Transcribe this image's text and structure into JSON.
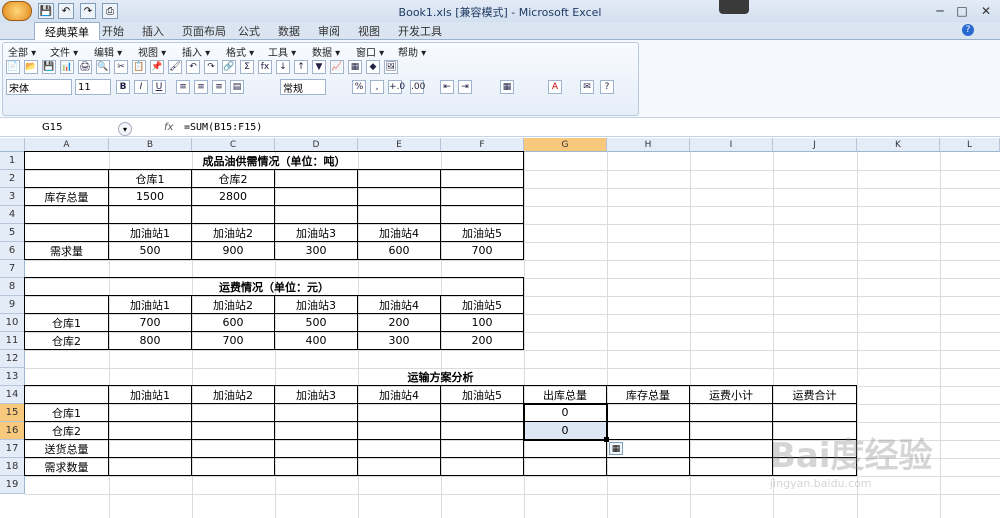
{
  "window": {
    "title": "Book1.xls  [兼容模式] - Microsoft Excel",
    "controls": {
      "minimize": "─",
      "restore": "□",
      "close": "✕"
    }
  },
  "quick_access": [
    "💾",
    "↶",
    "↷",
    "⎙"
  ],
  "ribbon_tabs": [
    "经典菜单",
    "开始",
    "插入",
    "页面布局",
    "公式",
    "数据",
    "审阅",
    "视图",
    "开发工具"
  ],
  "classic_menu": [
    "全部 ▾",
    "文件 ▾",
    "编辑 ▾",
    "视图 ▾",
    "插入 ▾",
    "格式 ▾",
    "工具 ▾",
    "数据 ▾",
    "窗口 ▾",
    "帮助 ▾"
  ],
  "toolbar": {
    "font_name": "宋体",
    "font_size": "11",
    "number_format": "常规",
    "row1_icons": [
      "📄",
      "📂",
      "💾",
      "📊",
      "🖨",
      "🔍",
      "✂",
      "📋",
      "📌",
      "🖌",
      "↶",
      "↷",
      "🔗",
      "Σ",
      "fx",
      "↓",
      "↑",
      "▼",
      "📈",
      "▦",
      "◆",
      "🖼"
    ],
    "row2_icons": [
      "B",
      "I",
      "U",
      "≡",
      "≡",
      "≡",
      "▤",
      "%",
      ",",
      "+.0",
      ".00",
      "⇤",
      "⇥",
      "▦",
      "A",
      "✉",
      "?"
    ]
  },
  "formula_bar": {
    "name_box": "G15",
    "fx": "fx",
    "formula": "=SUM(B15:F15)"
  },
  "sheet": {
    "columns": [
      "A",
      "B",
      "C",
      "D",
      "E",
      "F",
      "G",
      "H",
      "I",
      "J",
      "K",
      "L"
    ],
    "rows": [
      "1",
      "2",
      "3",
      "4",
      "5",
      "6",
      "7",
      "8",
      "9",
      "10",
      "11",
      "12",
      "13",
      "14",
      "15",
      "16",
      "17",
      "18",
      "19"
    ],
    "selected_column": "G",
    "titles": {
      "r1": "成品油供需情况（单位：吨）",
      "r8": "运费情况（单位：元）",
      "r13": "运输方案分析"
    },
    "r2": [
      "仓库1",
      "仓库2"
    ],
    "r3": {
      "label": "库存总量",
      "values": [
        "1500",
        "2800"
      ]
    },
    "r5": [
      "加油站1",
      "加油站2",
      "加油站3",
      "加油站4",
      "加油站5"
    ],
    "r6": {
      "label": "需求量",
      "values": [
        "500",
        "900",
        "300",
        "600",
        "700"
      ]
    },
    "r9": [
      "加油站1",
      "加油站2",
      "加油站3",
      "加油站4",
      "加油站5"
    ],
    "r10": {
      "label": "仓库1",
      "values": [
        "700",
        "600",
        "500",
        "200",
        "100"
      ]
    },
    "r11": {
      "label": "仓库2",
      "values": [
        "800",
        "700",
        "400",
        "300",
        "200"
      ]
    },
    "r14": [
      "加油站1",
      "加油站2",
      "加油站3",
      "加油站4",
      "加油站5",
      "出库总量",
      "库存总量",
      "运费小计",
      "运费合计"
    ],
    "r15": {
      "label": "仓库1",
      "G": "0"
    },
    "r16": {
      "label": "仓库2",
      "G": "0"
    },
    "r17": {
      "label": "送货总量"
    },
    "r18": {
      "label": "需求数量"
    }
  },
  "watermark": {
    "brand": "Bai度经验",
    "url": "jingyan.baidu.com"
  }
}
